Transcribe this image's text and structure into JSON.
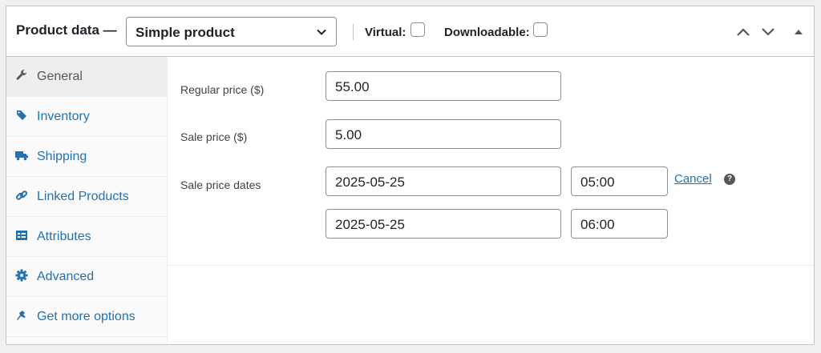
{
  "header": {
    "title": "Product data —",
    "product_type": "Simple product",
    "virtual_label": "Virtual:",
    "virtual_checked": false,
    "downloadable_label": "Downloadable:",
    "downloadable_checked": false
  },
  "sidebar": {
    "items": [
      {
        "label": "General",
        "icon": "wrench-icon",
        "active": true
      },
      {
        "label": "Inventory",
        "icon": "tag-icon",
        "active": false
      },
      {
        "label": "Shipping",
        "icon": "truck-icon",
        "active": false
      },
      {
        "label": "Linked Products",
        "icon": "link-icon",
        "active": false
      },
      {
        "label": "Attributes",
        "icon": "list-card-icon",
        "active": false
      },
      {
        "label": "Advanced",
        "icon": "gear-icon",
        "active": false
      },
      {
        "label": "Get more options",
        "icon": "plugin-icon",
        "active": false
      }
    ]
  },
  "general": {
    "regular_price_label": "Regular price ($)",
    "regular_price_value": "55.00",
    "sale_price_label": "Sale price ($)",
    "sale_price_value": "5.00",
    "sale_dates_label": "Sale price dates",
    "from_date": "2025-05-25",
    "from_time": "05:00",
    "to_date": "2025-05-25",
    "to_time": "06:00",
    "cancel_label": "Cancel",
    "help_glyph": "?"
  },
  "colors": {
    "link": "#2271b1",
    "border": "#c3c4c7",
    "active_tab_bg": "#eeeeee"
  }
}
